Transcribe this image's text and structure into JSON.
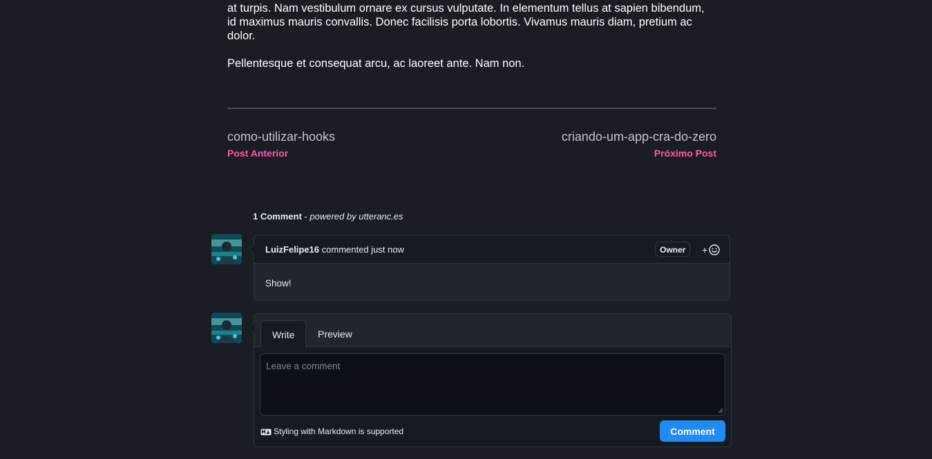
{
  "article": {
    "paragraph_1": "at turpis. Nam vestibulum ornare ex cursus vulputate. In elementum tellus at sapien bibendum, id maximus mauris convallis. Donec facilisis porta lobortis. Vivamus mauris diam, pretium ac dolor.",
    "paragraph_2": "Pellentesque et consequat arcu, ac laoreet ante. Nam non."
  },
  "post_nav": {
    "previous": {
      "slug": "como-utilizar-hooks",
      "label": "Post Anterior"
    },
    "next": {
      "slug": "criando-um-app-cra-do-zero",
      "label": "Próximo Post"
    }
  },
  "comments": {
    "count_label": "1 Comment",
    "separator": " - ",
    "powered_by": "powered by utteranc.es",
    "items": [
      {
        "author": "LuizFelipe16",
        "action": " commented just now",
        "badge": "Owner",
        "reaction_plus": "+",
        "body": "Show!"
      }
    ]
  },
  "editor": {
    "tabs": [
      "Write",
      "Preview"
    ],
    "placeholder": "Leave a comment",
    "markdown_hint": "Styling with Markdown is supported",
    "submit_label": "Comment"
  },
  "colors": {
    "background": "#1a1d23",
    "accent_pink": "#ff57b2",
    "button_blue": "#1f8cf5"
  },
  "icons": {
    "reaction": "smiley-icon",
    "markdown": "markdown-icon"
  }
}
